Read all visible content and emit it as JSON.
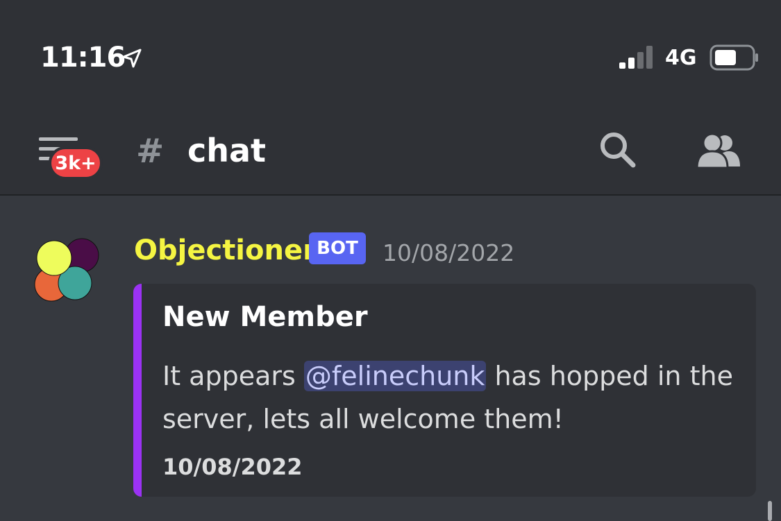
{
  "status_bar": {
    "time": "11:16",
    "network": "4G"
  },
  "header": {
    "notification_badge": "3k+",
    "channel_hash": "#",
    "channel_name": "chat"
  },
  "message": {
    "author": "Objectioner",
    "bot_tag": "BOT",
    "timestamp": "10/08/2022",
    "embed": {
      "title": "New Member",
      "description_before": "It appears ",
      "mention": "@felinechunk",
      "description_after": " has hopped in the server, lets all welcome them!",
      "footer": "10/08/2022",
      "accent_color": "#9b32f4"
    }
  },
  "colors": {
    "author": "#f5f542",
    "bot_tag": "#5865f2",
    "badge": "#ed4245",
    "background": "#36393f"
  }
}
